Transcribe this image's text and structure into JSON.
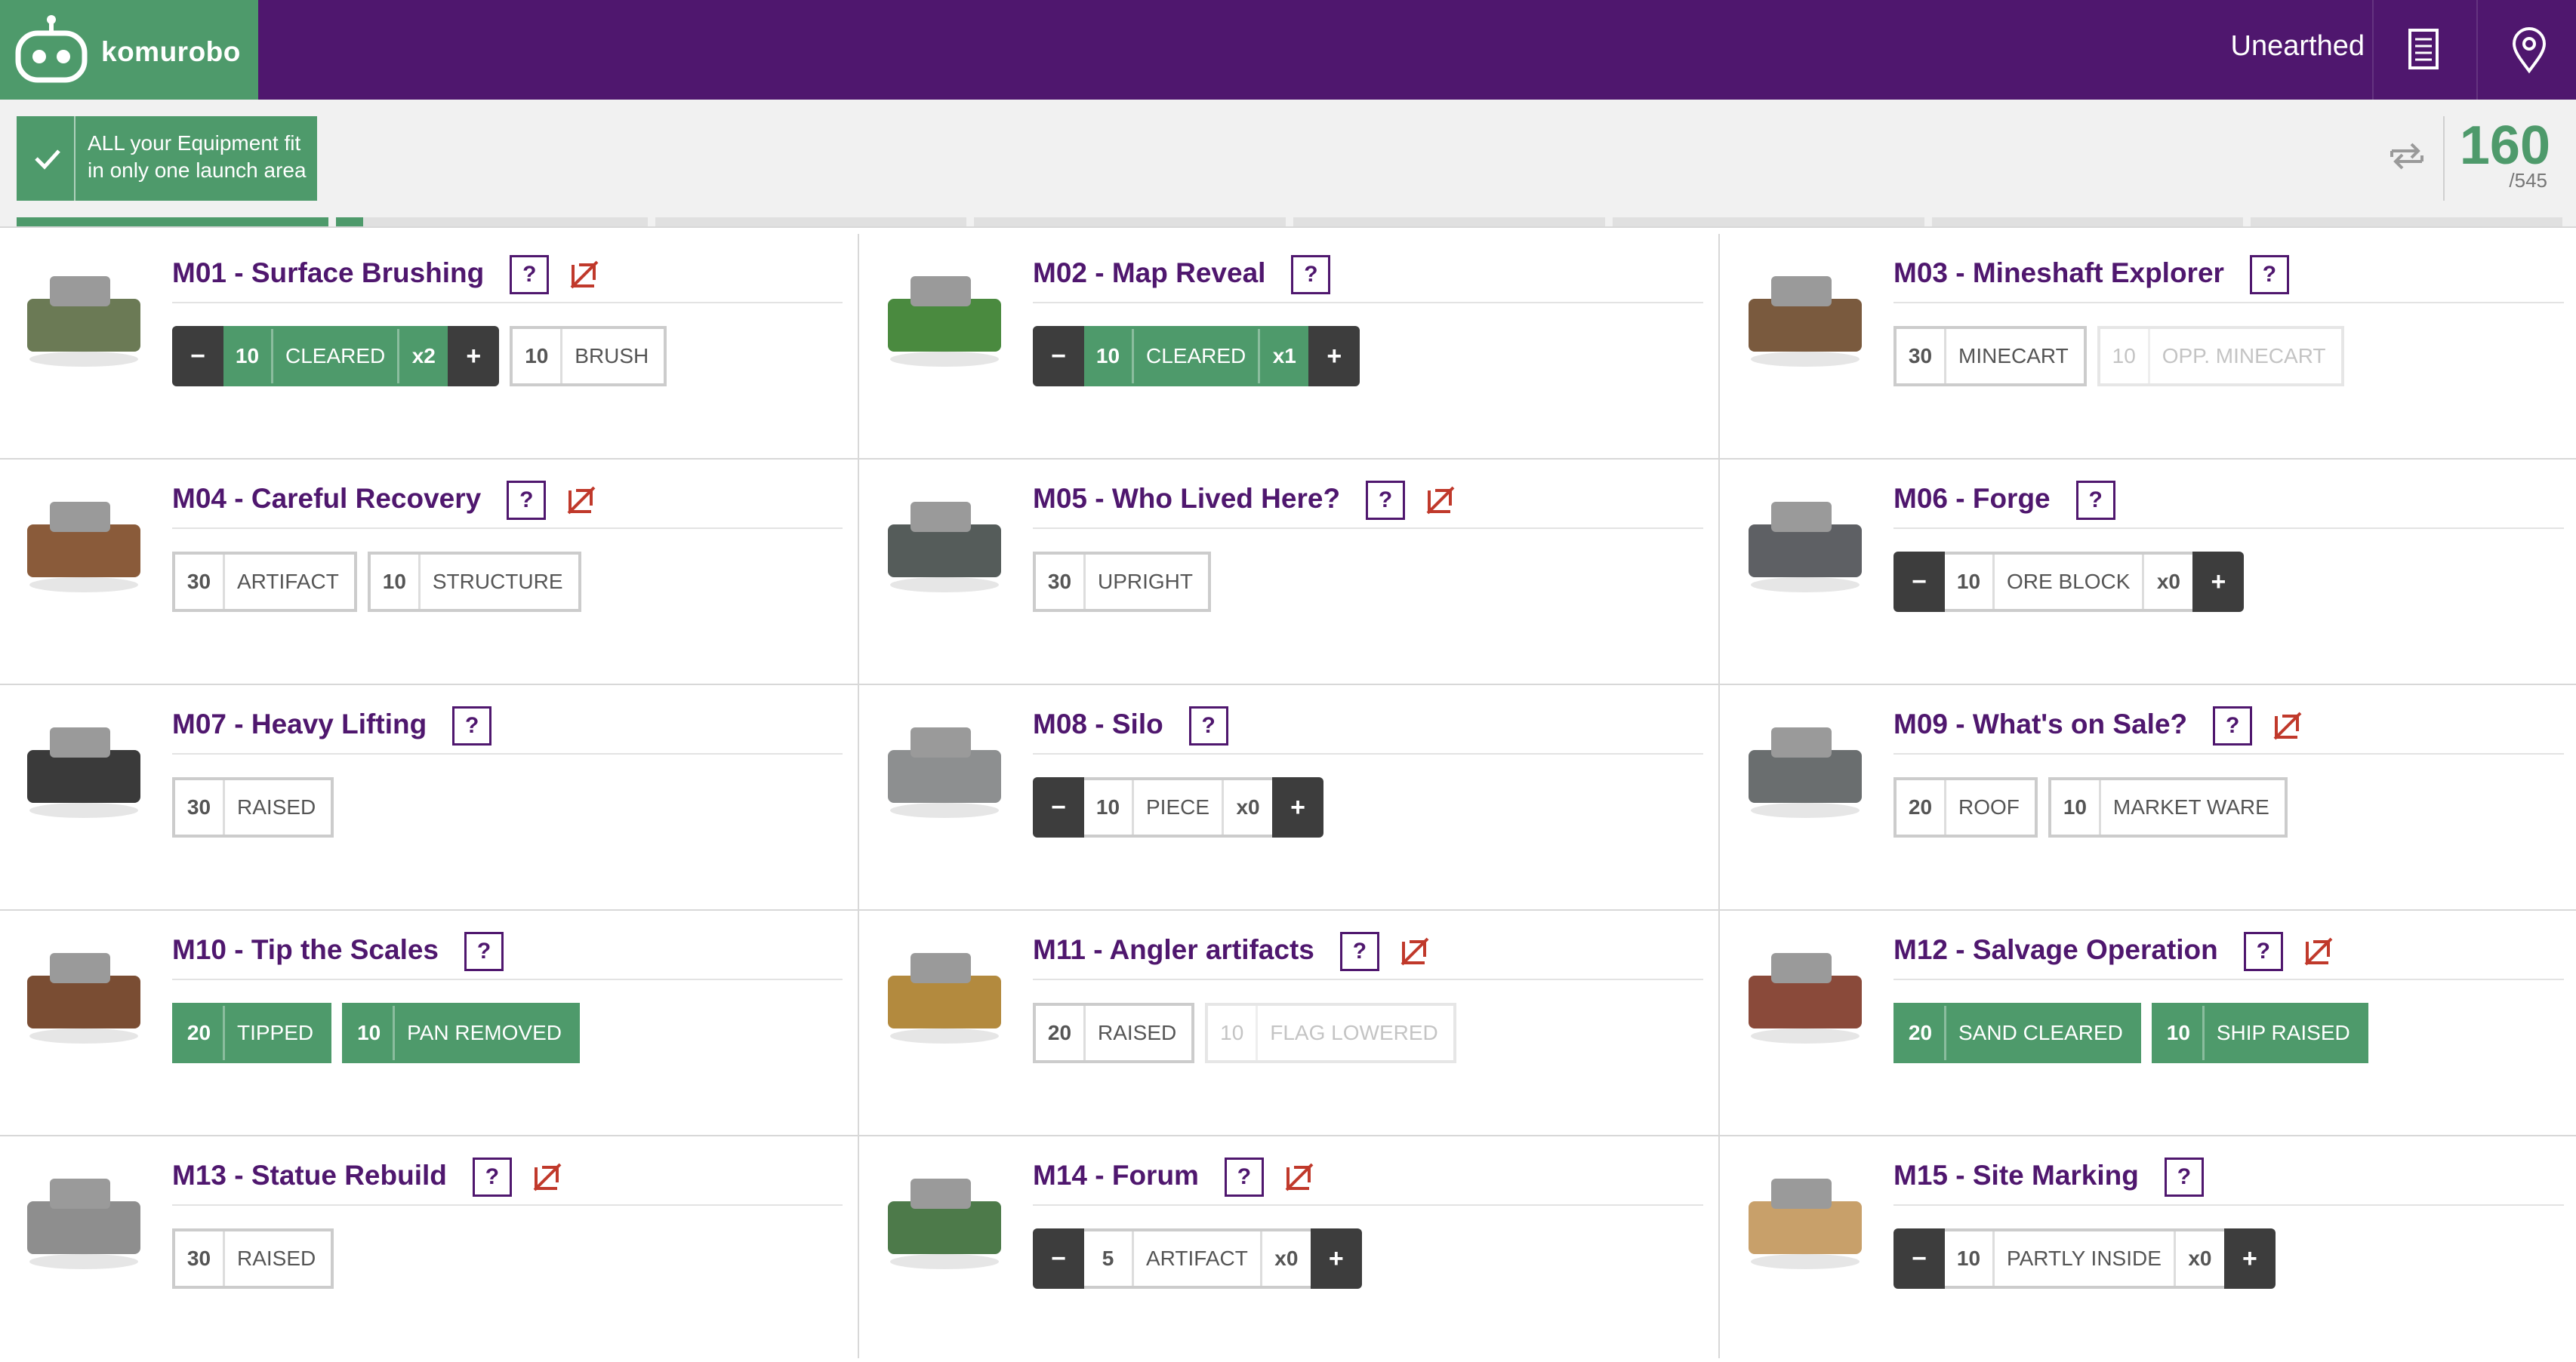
{
  "app": {
    "brand": "komurobo",
    "season": "Unearthed"
  },
  "header_icons": [
    "scoresheet-icon",
    "location-pin-icon"
  ],
  "status": {
    "banner_text": "ALL your Equipment fit in only one launch area",
    "score": "160",
    "score_max": "/545",
    "progress": {
      "segments": 8,
      "fraction": 0.136
    }
  },
  "colors": {
    "purple": "#4f176e",
    "green": "#4e9a6b",
    "dark": "#3d3d3d"
  },
  "help_label": "?",
  "missions": [
    {
      "id": "M01",
      "title": "M01 - Surface Brushing",
      "noninterference": true,
      "controls": [
        {
          "type": "counter",
          "points": "10",
          "label": "CLEARED",
          "mult": "x2",
          "active": true
        },
        {
          "type": "task",
          "points": "10",
          "label": "BRUSH",
          "state": "off"
        }
      ]
    },
    {
      "id": "M02",
      "title": "M02 - Map Reveal",
      "noninterference": false,
      "controls": [
        {
          "type": "counter",
          "points": "10",
          "label": "CLEARED",
          "mult": "x1",
          "active": true
        }
      ]
    },
    {
      "id": "M03",
      "title": "M03 - Mineshaft Explorer",
      "noninterference": false,
      "controls": [
        {
          "type": "task",
          "points": "30",
          "label": "MINECART",
          "state": "off"
        },
        {
          "type": "task",
          "points": "10",
          "label": "OPP. MINECART",
          "state": "disabled"
        }
      ]
    },
    {
      "id": "M04",
      "title": "M04 - Careful Recovery",
      "noninterference": true,
      "controls": [
        {
          "type": "task",
          "points": "30",
          "label": "ARTIFACT",
          "state": "off"
        },
        {
          "type": "task",
          "points": "10",
          "label": "STRUCTURE",
          "state": "off"
        }
      ]
    },
    {
      "id": "M05",
      "title": "M05 - Who Lived Here?",
      "noninterference": true,
      "controls": [
        {
          "type": "task",
          "points": "30",
          "label": "UPRIGHT",
          "state": "off"
        }
      ]
    },
    {
      "id": "M06",
      "title": "M06 - Forge",
      "noninterference": false,
      "controls": [
        {
          "type": "counter",
          "points": "10",
          "label": "ORE BLOCK",
          "mult": "x0",
          "active": false
        }
      ]
    },
    {
      "id": "M07",
      "title": "M07 - Heavy Lifting",
      "noninterference": false,
      "controls": [
        {
          "type": "task",
          "points": "30",
          "label": "RAISED",
          "state": "off"
        }
      ]
    },
    {
      "id": "M08",
      "title": "M08 - Silo",
      "noninterference": false,
      "controls": [
        {
          "type": "counter",
          "points": "10",
          "label": "PIECE",
          "mult": "x0",
          "active": false
        }
      ]
    },
    {
      "id": "M09",
      "title": "M09 - What's on Sale?",
      "noninterference": true,
      "controls": [
        {
          "type": "task",
          "points": "20",
          "label": "ROOF",
          "state": "off"
        },
        {
          "type": "task",
          "points": "10",
          "label": "MARKET WARE",
          "state": "off"
        }
      ]
    },
    {
      "id": "M10",
      "title": "M10 - Tip the Scales",
      "noninterference": false,
      "controls": [
        {
          "type": "task",
          "points": "20",
          "label": "TIPPED",
          "state": "on"
        },
        {
          "type": "task",
          "points": "10",
          "label": "PAN REMOVED",
          "state": "on"
        }
      ]
    },
    {
      "id": "M11",
      "title": "M11 - Angler artifacts",
      "noninterference": true,
      "controls": [
        {
          "type": "task",
          "points": "20",
          "label": "RAISED",
          "state": "off"
        },
        {
          "type": "task",
          "points": "10",
          "label": "FLAG LOWERED",
          "state": "disabled"
        }
      ]
    },
    {
      "id": "M12",
      "title": "M12 - Salvage Operation",
      "noninterference": true,
      "controls": [
        {
          "type": "task",
          "points": "20",
          "label": "SAND CLEARED",
          "state": "on"
        },
        {
          "type": "task",
          "points": "10",
          "label": "SHIP RAISED",
          "state": "on"
        }
      ]
    },
    {
      "id": "M13",
      "title": "M13 - Statue Rebuild",
      "noninterference": true,
      "controls": [
        {
          "type": "task",
          "points": "30",
          "label": "RAISED",
          "state": "off"
        }
      ]
    },
    {
      "id": "M14",
      "title": "M14 - Forum",
      "noninterference": true,
      "controls": [
        {
          "type": "counter",
          "points": "5",
          "label": "ARTIFACT",
          "mult": "x0",
          "active": false
        }
      ]
    },
    {
      "id": "M15",
      "title": "M15 - Site Marking",
      "noninterference": false,
      "controls": [
        {
          "type": "counter",
          "points": "10",
          "label": "PARTLY INSIDE",
          "mult": "x0",
          "active": false
        }
      ]
    }
  ]
}
